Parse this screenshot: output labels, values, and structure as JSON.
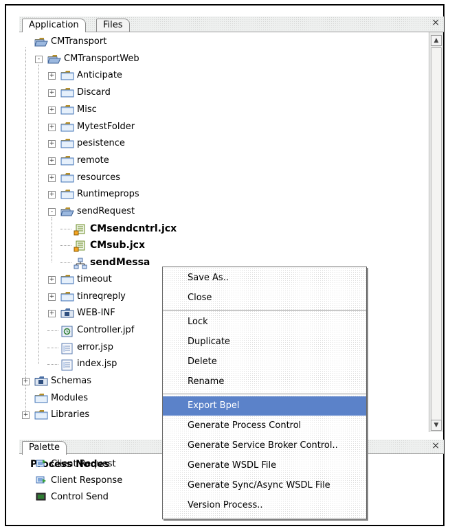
{
  "panel": {
    "tabs": [
      {
        "label": "Application",
        "active": true
      },
      {
        "label": "Files",
        "active": false
      }
    ],
    "close_glyph": "×"
  },
  "tree": [
    {
      "label": "CMTransport",
      "level": 0,
      "expander": "",
      "icon": "project-folder-icon",
      "bold": false
    },
    {
      "label": "CMTransportWeb",
      "level": 1,
      "expander": "-",
      "icon": "web-project-folder-icon",
      "bold": false
    },
    {
      "label": "Anticipate",
      "level": 2,
      "expander": "+",
      "icon": "folder-icon",
      "bold": false
    },
    {
      "label": "Discard",
      "level": 2,
      "expander": "+",
      "icon": "folder-icon",
      "bold": false
    },
    {
      "label": "Misc",
      "level": 2,
      "expander": "+",
      "icon": "folder-icon",
      "bold": false
    },
    {
      "label": "MytestFolder",
      "level": 2,
      "expander": "+",
      "icon": "folder-icon",
      "bold": false
    },
    {
      "label": "pesistence",
      "level": 2,
      "expander": "+",
      "icon": "folder-icon",
      "bold": false
    },
    {
      "label": "remote",
      "level": 2,
      "expander": "+",
      "icon": "folder-icon",
      "bold": false
    },
    {
      "label": "resources",
      "level": 2,
      "expander": "+",
      "icon": "folder-icon",
      "bold": false
    },
    {
      "label": "Runtimeprops",
      "level": 2,
      "expander": "+",
      "icon": "folder-icon",
      "bold": false
    },
    {
      "label": "sendRequest",
      "level": 2,
      "expander": "-",
      "icon": "open-folder-icon",
      "bold": false
    },
    {
      "label": "CMsendcntrl.jcx",
      "level": 3,
      "expander": "",
      "icon": "control-file-icon",
      "bold": true
    },
    {
      "label": "CMsub.jcx",
      "level": 3,
      "expander": "",
      "icon": "control-file-icon",
      "bold": true
    },
    {
      "label": "sendMessa",
      "level": 3,
      "expander": "",
      "icon": "process-file-icon",
      "bold": true
    },
    {
      "label": "timeout",
      "level": 2,
      "expander": "+",
      "icon": "folder-icon",
      "bold": false
    },
    {
      "label": "tinreqreply",
      "level": 2,
      "expander": "+",
      "icon": "folder-icon",
      "bold": false
    },
    {
      "label": "WEB-INF",
      "level": 2,
      "expander": "+",
      "icon": "web-inf-folder-icon",
      "bold": false
    },
    {
      "label": "Controller.jpf",
      "level": 2,
      "expander": "",
      "icon": "page-flow-file-icon",
      "bold": false
    },
    {
      "label": "error.jsp",
      "level": 2,
      "expander": "",
      "icon": "jsp-file-icon",
      "bold": false
    },
    {
      "label": "index.jsp",
      "level": 2,
      "expander": "",
      "icon": "jsp-file-icon",
      "bold": false
    },
    {
      "label": "Schemas",
      "level": 0,
      "expander": "+",
      "icon": "schemas-folder-icon",
      "bold": false
    },
    {
      "label": "Modules",
      "level": 0,
      "expander": "",
      "icon": "folder-icon",
      "bold": false
    },
    {
      "label": "Libraries",
      "level": 0,
      "expander": "+",
      "icon": "folder-icon",
      "bold": false
    }
  ],
  "scrollbar": {
    "up_glyph": "▲",
    "down_glyph": "▼"
  },
  "palette": {
    "tab_label": "Palette",
    "close_glyph": "×",
    "section_title": "Process Nodes",
    "items": [
      {
        "label": "Client Request",
        "icon": "client-request-icon"
      },
      {
        "label": "Client Response",
        "icon": "client-response-icon"
      },
      {
        "label": "Control Send",
        "icon": "control-send-icon"
      }
    ]
  },
  "context_menu": {
    "items": [
      {
        "label": "Save As..",
        "highlighted": false
      },
      {
        "label": "Close",
        "highlighted": false,
        "separator_after": true
      },
      {
        "label": "Lock",
        "highlighted": false
      },
      {
        "label": "Duplicate",
        "highlighted": false
      },
      {
        "label": "Delete",
        "highlighted": false
      },
      {
        "label": "Rename",
        "highlighted": false,
        "separator_after": true
      },
      {
        "label": "Export Bpel",
        "highlighted": true
      },
      {
        "label": "Generate Process Control",
        "highlighted": false
      },
      {
        "label": "Generate Service Broker Control..",
        "highlighted": false
      },
      {
        "label": "Generate WSDL File",
        "highlighted": false
      },
      {
        "label": "Generate Sync/Async WSDL File",
        "highlighted": false
      },
      {
        "label": "Version Process..",
        "highlighted": false
      }
    ]
  },
  "colors": {
    "highlight": "#5b82c9",
    "folder": "#f2c94c",
    "folder_dark": "#b8902a"
  }
}
